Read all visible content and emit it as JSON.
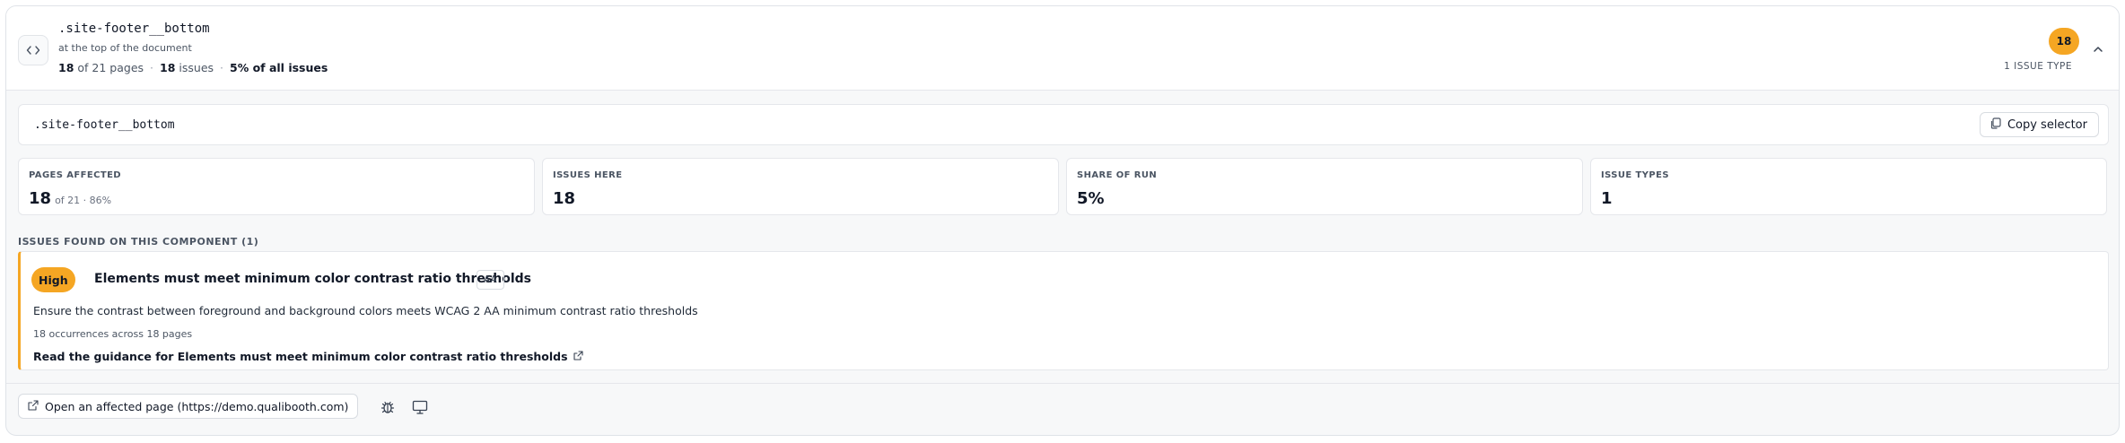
{
  "component": {
    "selector": ".site-footer__bottom",
    "location": "at the top of the document",
    "pages_affected": "18",
    "pages_total_text": "of 21 pages",
    "issues_count": "18",
    "issues_word": "issues",
    "share_text": "5% of all issues",
    "badge_count": "18",
    "issue_type_label": "1 ISSUE TYPE"
  },
  "selector_box": {
    "selector": ".site-footer__bottom",
    "copy_label": "Copy selector"
  },
  "stats": [
    {
      "label": "PAGES AFFECTED",
      "value": "18",
      "extra": "of 21 · 86%"
    },
    {
      "label": "ISSUES HERE",
      "value": "18",
      "extra": ""
    },
    {
      "label": "SHARE OF RUN",
      "value": "5%",
      "extra": ""
    },
    {
      "label": "ISSUE TYPES",
      "value": "1",
      "extra": ""
    }
  ],
  "issues_section": {
    "heading": "ISSUES FOUND ON THIS COMPONENT (1)",
    "issues": [
      {
        "severity": "High",
        "title": "Elements must meet minimum color contrast ratio thresholds",
        "level": "AA",
        "description": "Ensure the contrast between foreground and background colors meets WCAG 2 AA minimum contrast ratio thresholds",
        "occurrences": "18 occurrences across 18 pages",
        "guidance_link": "Read the guidance for Elements must meet minimum color contrast ratio thresholds"
      }
    ]
  },
  "footer": {
    "open_page_label": "Open an affected page (https://demo.qualibooth.com)",
    "tools": [
      "bug-icon",
      "monitor-icon"
    ]
  },
  "colors": {
    "accent": "#f5a623",
    "text": "#111827",
    "muted": "#4b5563",
    "border": "#e5e7eb"
  }
}
